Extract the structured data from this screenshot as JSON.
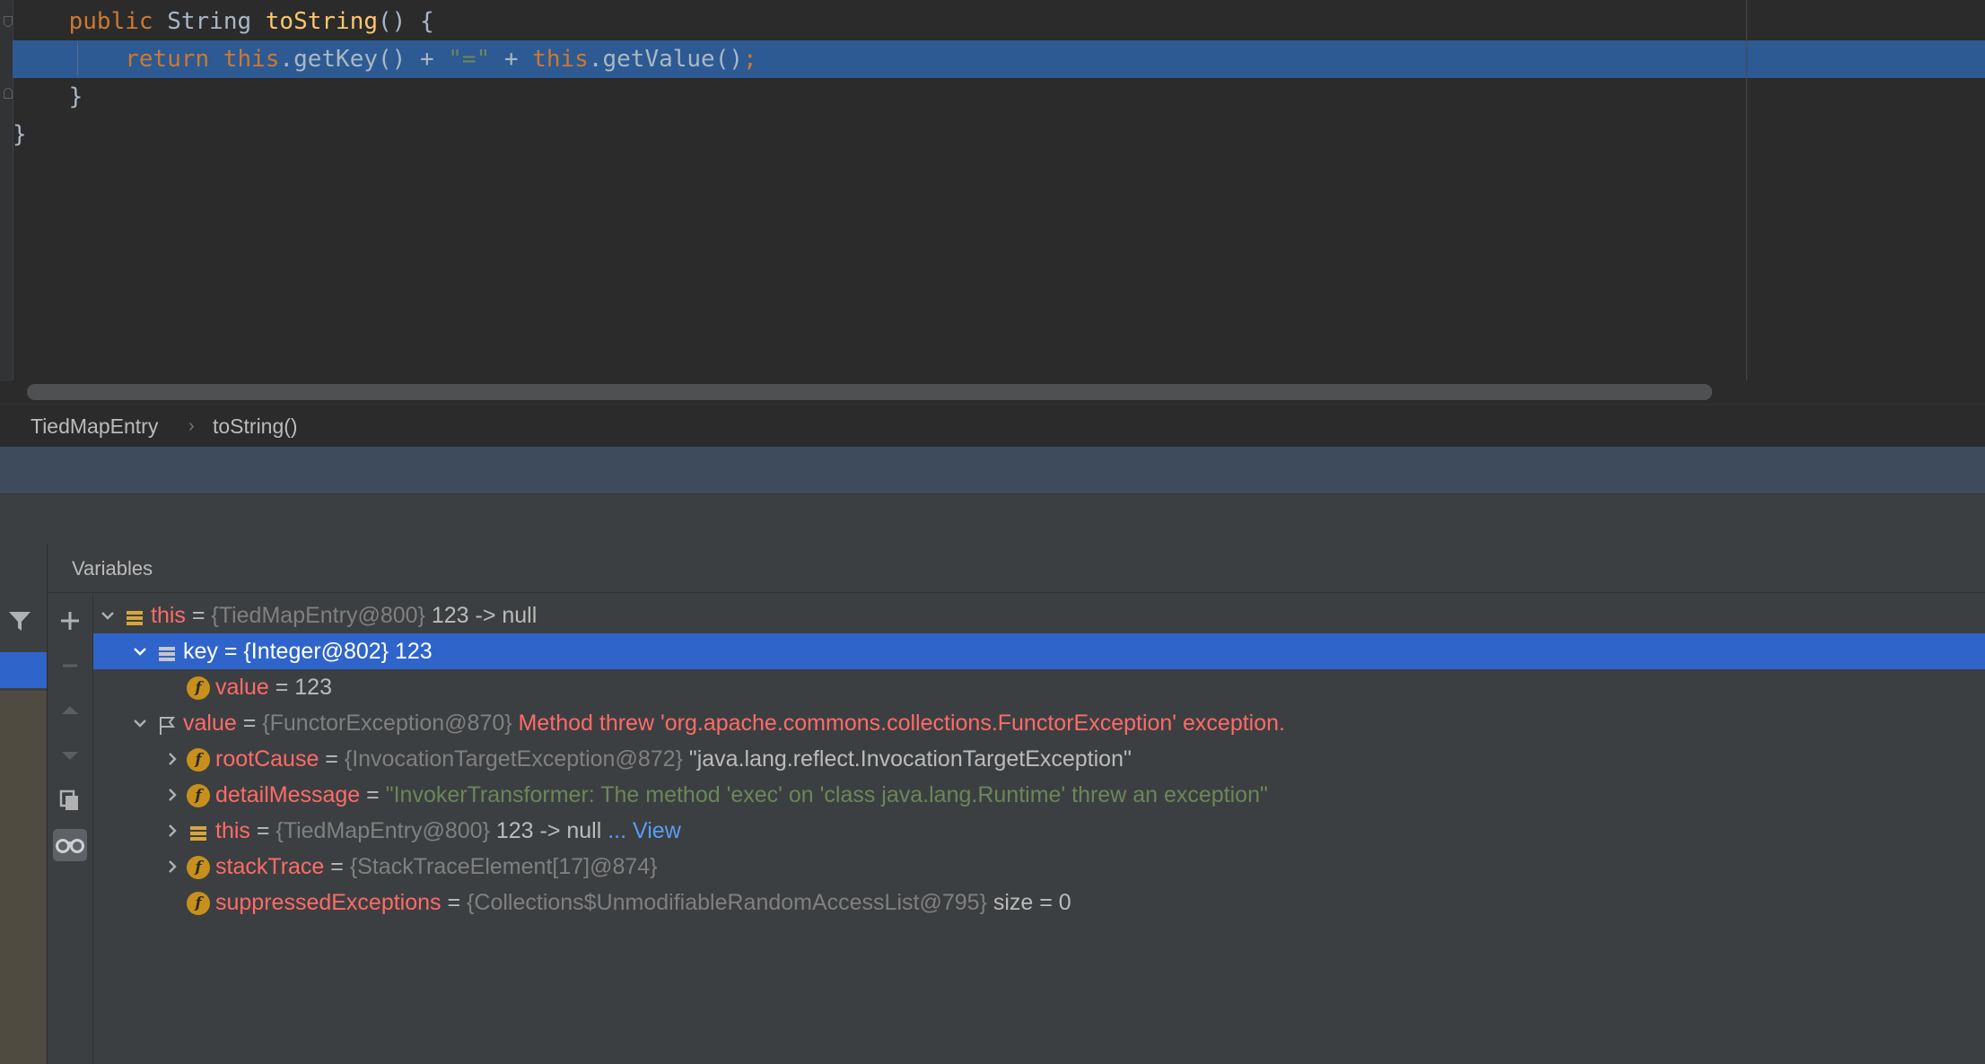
{
  "editor": {
    "lines": [
      {
        "indent": "    ",
        "tokens": [
          [
            "kw",
            "public "
          ],
          [
            "tx",
            "String "
          ],
          [
            "fn",
            "toString"
          ],
          [
            "tx",
            "() {"
          ]
        ]
      },
      {
        "indent": "        ",
        "tokens": [
          [
            "kw",
            "return this"
          ],
          [
            "tx",
            ".getKey() + "
          ],
          [
            "str",
            "\"=\""
          ],
          [
            "tx",
            " + "
          ],
          [
            "kw",
            "this"
          ],
          [
            "tx",
            ".getValue()"
          ],
          [
            "kw",
            ";"
          ]
        ]
      },
      {
        "indent": "    ",
        "tokens": [
          [
            "tx",
            "}"
          ]
        ]
      },
      {
        "indent": "",
        "tokens": [
          [
            "tx",
            "}"
          ]
        ]
      }
    ],
    "highlight_color": "#2d5a92"
  },
  "breadcrumb": {
    "class_name": "TiedMapEntry",
    "separator": "›",
    "method_name": "toString()"
  },
  "variables": {
    "title": "Variables",
    "toolbar_icons": [
      "add-icon",
      "remove-icon",
      "up-arrow-icon",
      "down-arrow-icon",
      "copy-icon",
      "watches-glasses-icon"
    ],
    "rows": [
      {
        "name": "this",
        "eq": " = ",
        "type": "{TiedMapEntry@800}",
        "value": " 123 -> null"
      },
      {
        "name": "key",
        "eq": " = ",
        "type": "{Integer@802}",
        "value": " 123"
      },
      {
        "name": "value",
        "eq": " = ",
        "type": "",
        "value": "123"
      },
      {
        "name": "value",
        "eq": " = ",
        "type": "{FunctorException@870}",
        "error": " Method threw 'org.apache.commons.collections.FunctorException' exception."
      },
      {
        "name": "rootCause",
        "eq": " = ",
        "type": "{InvocationTargetException@872}",
        "value": " \"java.lang.reflect.InvocationTargetException\""
      },
      {
        "name": "detailMessage",
        "eq": " = ",
        "type": "",
        "string_value": "\"InvokerTransformer: The method 'exec' on 'class java.lang.Runtime' threw an exception\""
      },
      {
        "name": "this",
        "eq": " = ",
        "type": "{TiedMapEntry@800}",
        "value": " 123 -> null",
        "link_prefix": " ... ",
        "link": "View"
      },
      {
        "name": "stackTrace",
        "eq": " = ",
        "type": "{StackTraceElement[17]@874}",
        "value": ""
      },
      {
        "name": "suppressedExceptions",
        "eq": " = ",
        "type": "{Collections$UnmodifiableRandomAccessList@795}",
        "value": "  size = 0"
      }
    ],
    "selected_row": 1
  },
  "colors": {
    "selection": "#2f65ca",
    "field_badge": "#c7901a",
    "error_text": "#ff6b68",
    "string_value": "#6a8759"
  }
}
